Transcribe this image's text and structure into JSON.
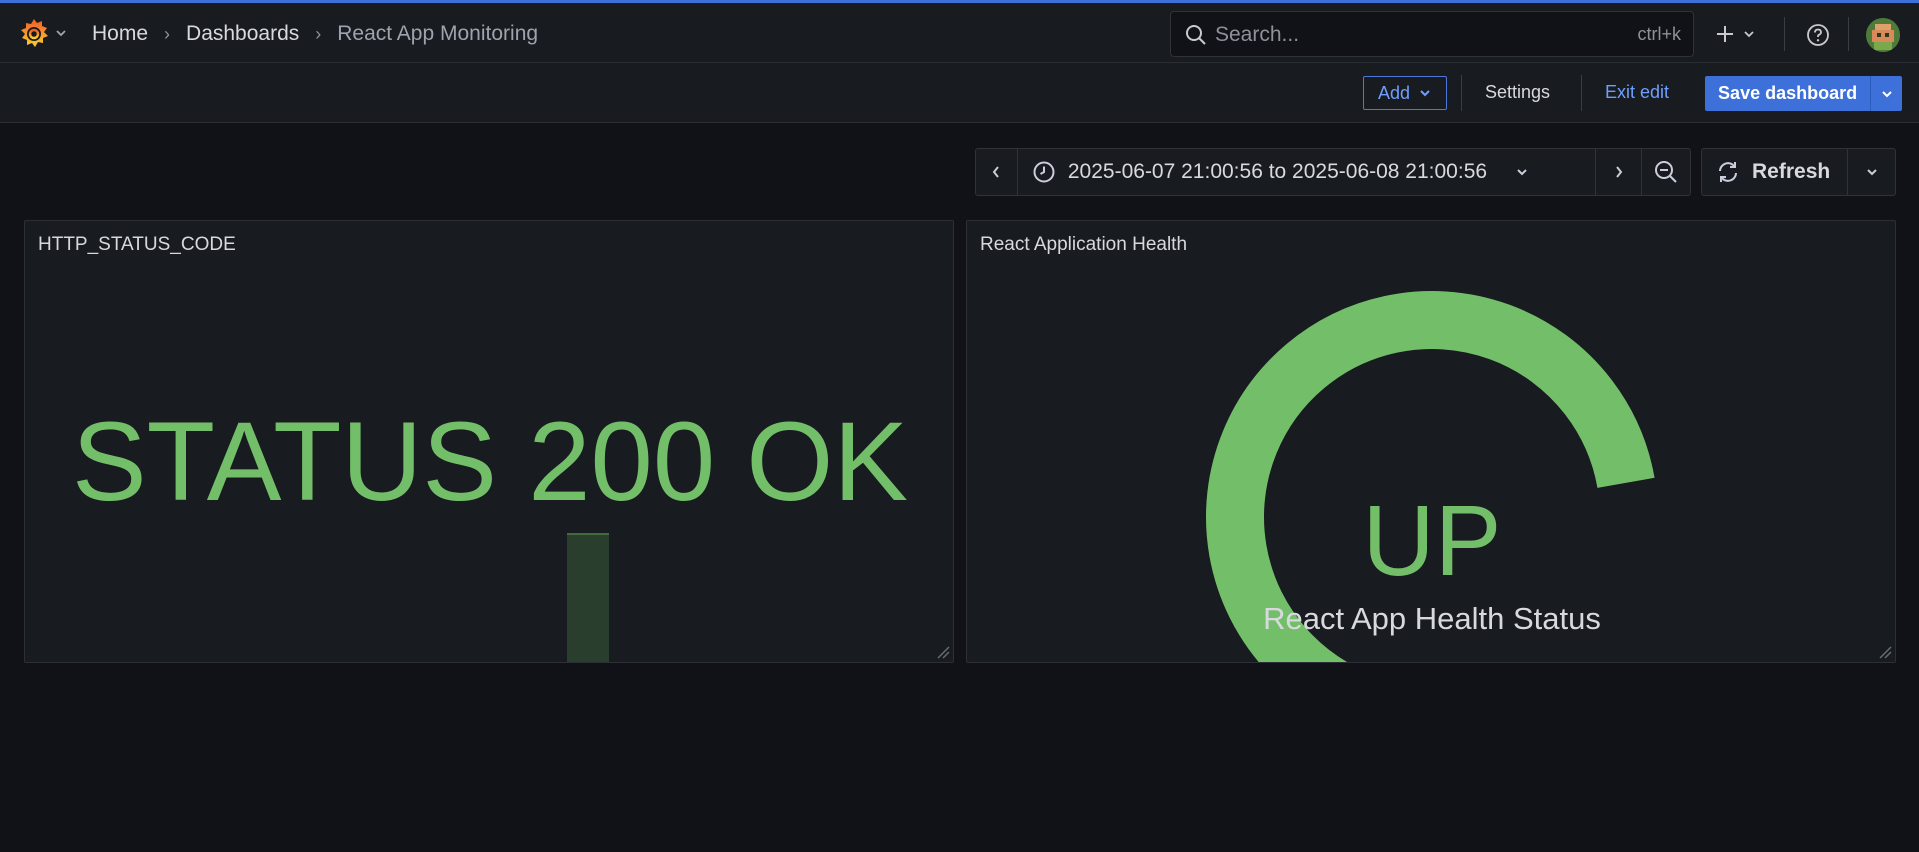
{
  "nav": {
    "breadcrumbs": [
      "Home",
      "Dashboards",
      "React App Monitoring"
    ],
    "search_placeholder": "Search...",
    "search_shortcut": "ctrl+k"
  },
  "toolbar": {
    "add_label": "Add",
    "settings_label": "Settings",
    "exit_edit_label": "Exit edit",
    "save_label": "Save dashboard"
  },
  "timepicker": {
    "range": "2025-06-07 21:00:56 to 2025-06-08 21:00:56",
    "refresh_label": "Refresh"
  },
  "panels": {
    "left": {
      "title": "HTTP_STATUS_CODE",
      "value": "STATUS 200 OK"
    },
    "right": {
      "title": "React Application Health",
      "value": "UP",
      "subtitle": "React App Health Status",
      "gauge_fill": 1.0
    }
  },
  "colors": {
    "accent": "#3d71d9",
    "ok_green": "#73bf69",
    "link": "#6e9fff",
    "background": "#111217",
    "panel": "#181b1f"
  },
  "icons": [
    "grafana-logo-icon",
    "chevron-down-icon",
    "chevron-right-icon",
    "search-icon",
    "plus-icon",
    "help-icon",
    "avatar",
    "chevron-left-icon",
    "clock-icon",
    "zoom-out-icon",
    "refresh-icon",
    "resize-handle-icon"
  ]
}
